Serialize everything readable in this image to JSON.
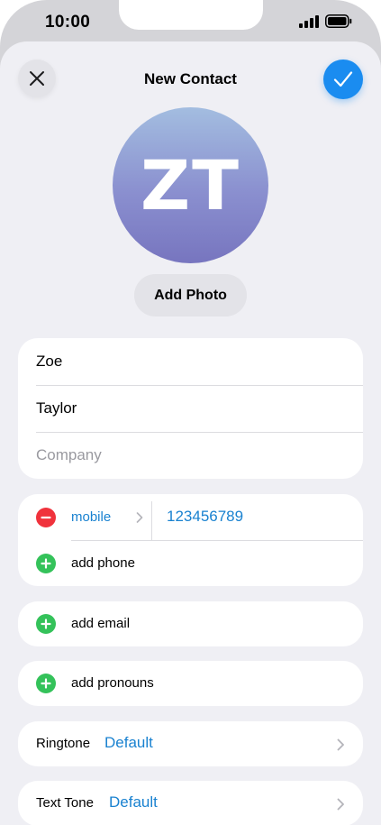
{
  "status_bar": {
    "time": "10:00"
  },
  "header": {
    "title": "New Contact",
    "close_icon": "close-icon",
    "done_icon": "checkmark-icon",
    "accent_color": "#1a8cf0"
  },
  "avatar": {
    "initials": "ZT",
    "add_photo_label": "Add Photo"
  },
  "name_fields": {
    "first_name": "Zoe",
    "last_name": "Taylor",
    "company_placeholder": "Company"
  },
  "phone": {
    "type_label": "mobile",
    "number": "123456789",
    "add_phone_label": "add phone",
    "remove_icon": "minus-circle-icon",
    "add_icon": "plus-circle-icon"
  },
  "email": {
    "add_label": "add email"
  },
  "pronouns": {
    "add_label": "add pronouns"
  },
  "ringtone": {
    "label": "Ringtone",
    "value": "Default"
  },
  "text_tone": {
    "label": "Text Tone",
    "value": "Default"
  },
  "colors": {
    "link_blue": "#1a82d0",
    "remove_red": "#f0323c",
    "add_green": "#34c25a",
    "background": "#efeff4"
  }
}
